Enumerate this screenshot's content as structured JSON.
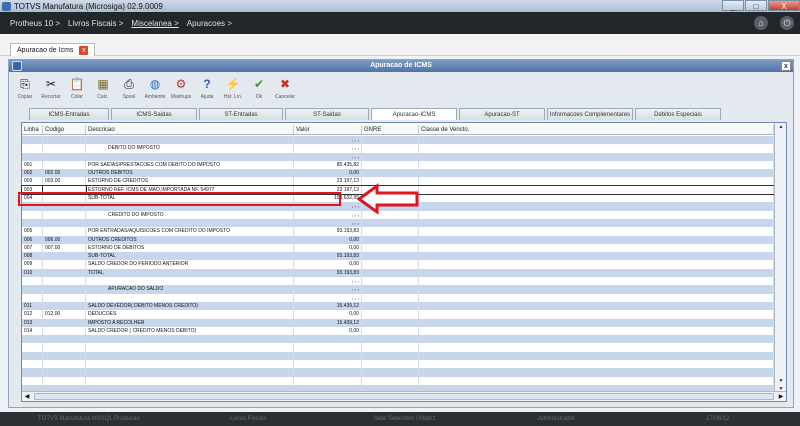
{
  "window": {
    "title": "TOTVS Manufatura (Microsiga) 02.9.0009",
    "minimize": "_",
    "maximize": "□",
    "close": "X"
  },
  "menubar": {
    "items": [
      "Protheus 10 >",
      "Livros Fiscais >",
      "Miscelanea >",
      "Apuracoes >"
    ]
  },
  "doc_tab": {
    "label": "Apuracao de Icms",
    "close": "x"
  },
  "form": {
    "title": "Apuracao de ICMS",
    "close": "x"
  },
  "toolbar": [
    {
      "label": "Copiar",
      "icon": "copy-icon",
      "glyph": "⎘"
    },
    {
      "label": "Recortar",
      "icon": "cut-icon",
      "glyph": "✂"
    },
    {
      "label": "Colar",
      "icon": "paste-icon",
      "glyph": "📋"
    },
    {
      "label": "Calc.",
      "icon": "calculator-icon",
      "glyph": "▦"
    },
    {
      "label": "Spool",
      "icon": "printer-icon",
      "glyph": "⎙"
    },
    {
      "label": "Ambiente",
      "icon": "globe-icon",
      "glyph": "◍"
    },
    {
      "label": "Mashups",
      "icon": "network-icon",
      "glyph": "⚙"
    },
    {
      "label": "Ajuda",
      "icon": "help-icon",
      "glyph": "?"
    },
    {
      "label": "Hst. Lin.",
      "icon": "history-icon",
      "glyph": "⚡"
    },
    {
      "label": "Ok",
      "icon": "check-icon",
      "glyph": "✔"
    },
    {
      "label": "Cancelar",
      "icon": "cancel-icon",
      "glyph": "✖"
    }
  ],
  "tabs": [
    {
      "label": "ICMS-Entradas",
      "active": false
    },
    {
      "label": "ICMS-Saidas",
      "active": false
    },
    {
      "label": "ST-Entradas",
      "active": false
    },
    {
      "label": "ST-Saidas",
      "active": false
    },
    {
      "label": "Apuracao-ICMS",
      "active": true
    },
    {
      "label": "Apuracao-ST",
      "active": false
    },
    {
      "label": "Informacoes Complementares",
      "active": false
    },
    {
      "label": "Débitos Especiais",
      "active": false
    }
  ],
  "grid": {
    "columns": {
      "linha": "Linha",
      "codigo": "Codigo",
      "descricao": "Descricao",
      "valor": "Valor",
      "gnre": "GNRE",
      "classe": "Classe de Vencto."
    },
    "rows": [
      {
        "linha": "",
        "codigo": "",
        "descricao": "",
        "valor": ", , ,"
      },
      {
        "linha": "",
        "codigo": "",
        "descricao": "DEBITO DO IMPOSTO",
        "valor": ", , ,"
      },
      {
        "linha": "",
        "codigo": "",
        "descricao": "",
        "valor": ", , ,"
      },
      {
        "linha": "001",
        "codigo": "",
        "descricao": "POR SAIDAS/PRESTACOES COM DEBITO DO IMPOSTO",
        "valor": "85.435,82"
      },
      {
        "linha": "002",
        "codigo": "002.00",
        "descricao": "OUTROS DEBITOS",
        "valor": "0,00"
      },
      {
        "linha": "003",
        "codigo": "003.00",
        "descricao": "ESTORNO DE CREDITOS",
        "valor": "23.197,13"
      },
      {
        "linha": "003",
        "codigo": "",
        "descricao": "ESTORNO REF. ICMS DE MAO,IMPORTADA NF. 54977",
        "valor": "23.197,13"
      },
      {
        "linha": "004",
        "codigo": "",
        "descricao": "SUB-TOTAL",
        "valor": "108.632,95"
      },
      {
        "linha": "",
        "codigo": "",
        "descricao": "",
        "valor": ", , ,"
      },
      {
        "linha": "",
        "codigo": "",
        "descricao": "CREDITO DO IMPOSTO",
        "valor": ", , ,"
      },
      {
        "linha": "",
        "codigo": "",
        "descricao": "",
        "valor": ", , ,"
      },
      {
        "linha": "005",
        "codigo": "",
        "descricao": "POR ENTRADAS/AQUISICOES COM CREDITO DO IMPOSTO",
        "valor": "93.193,83"
      },
      {
        "linha": "006",
        "codigo": "006.00",
        "descricao": "OUTROS CREDITOS",
        "valor": "0,00"
      },
      {
        "linha": "007",
        "codigo": "007.00",
        "descricao": "ESTORNO DE DEBITOS",
        "valor": "0,00"
      },
      {
        "linha": "008",
        "codigo": "",
        "descricao": "SUB-TOTAL",
        "valor": "93.193,83"
      },
      {
        "linha": "009",
        "codigo": "",
        "descricao": "SALDO CREDOR DO PERIODO ANTERIOR",
        "valor": "0,00"
      },
      {
        "linha": "010",
        "codigo": "",
        "descricao": "TOTAL",
        "valor": "93.193,83"
      },
      {
        "linha": "",
        "codigo": "",
        "descricao": "",
        "valor": ", , ,"
      },
      {
        "linha": "",
        "codigo": "",
        "descricao": "APURACAO DO SALDO",
        "valor": ", , ,"
      },
      {
        "linha": "",
        "codigo": "",
        "descricao": "",
        "valor": ", , ,"
      },
      {
        "linha": "011",
        "codigo": "",
        "descricao": "SALDO DEVEDOR( DEBITO MENOS CREDITO)",
        "valor": "15.439,12"
      },
      {
        "linha": "012",
        "codigo": "012.00",
        "descricao": "DEDUCOES",
        "valor": "0,00"
      },
      {
        "linha": "013",
        "codigo": "",
        "descricao": "IMPOSTO A RECOLHER",
        "valor": "15.439,12"
      },
      {
        "linha": "014",
        "codigo": "",
        "descricao": "SALDO CREDOR ( CREDITO MENOS DEBITO)",
        "valor": "0,00"
      },
      {
        "linha": "",
        "codigo": "",
        "descricao": "",
        "valor": ""
      },
      {
        "linha": "",
        "codigo": "",
        "descricao": "",
        "valor": ""
      },
      {
        "linha": "",
        "codigo": "",
        "descricao": "",
        "valor": ""
      },
      {
        "linha": "",
        "codigo": "",
        "descricao": "",
        "valor": ""
      },
      {
        "linha": "",
        "codigo": "",
        "descricao": "",
        "valor": ""
      },
      {
        "linha": "",
        "codigo": "",
        "descricao": "",
        "valor": ""
      },
      {
        "linha": "",
        "codigo": "",
        "descricao": "",
        "valor": ""
      }
    ]
  },
  "statusbar": {
    "app": "TOTVS Manufatura MSSQL Producao",
    "module": "Livros Fiscais",
    "branch": "Sete Setembro / Matriz",
    "user": "Administrador",
    "date": "17/06/12"
  },
  "colors": {
    "annotation": "#e0141e",
    "row_alt": "#c7d6ea",
    "form_title": "#4f73a4"
  }
}
